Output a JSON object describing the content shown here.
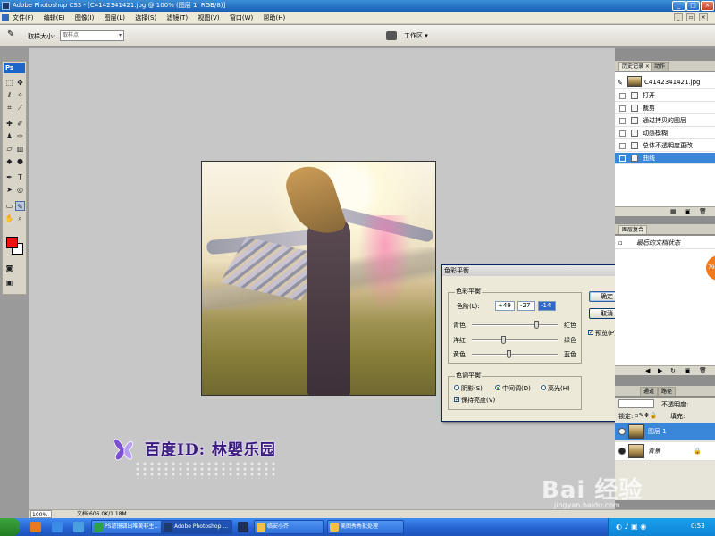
{
  "window": {
    "title": "Adobe Photoshop CS3 - [C4142341421.jpg @ 100% (图层 1, RGB/8)]"
  },
  "menubar": {
    "items": [
      "文件(F)",
      "编辑(E)",
      "图像(I)",
      "图层(L)",
      "选择(S)",
      "滤镜(T)",
      "视图(V)",
      "窗口(W)",
      "帮助(H)"
    ]
  },
  "options_bar": {
    "sample_size_label": "取样大小:",
    "sample_size_value": "取样点",
    "workspace_label": "工作区 ▾"
  },
  "toolbox": {
    "logo": "Ps",
    "foreground_color": "#f01010",
    "background_color": "#ffffff"
  },
  "watermark": {
    "text": "百度ID: 林婴乐园"
  },
  "color_balance": {
    "title": "色彩平衡",
    "group_color_balance": "色彩平衡",
    "levels_label": "色阶(L):",
    "levels": [
      "+49",
      "-27",
      "-14"
    ],
    "sliders": [
      {
        "left": "青色",
        "right": "红色",
        "value": 49
      },
      {
        "left": "洋红",
        "right": "绿色",
        "value": -27
      },
      {
        "left": "黄色",
        "right": "蓝色",
        "value": -14
      }
    ],
    "group_tone_balance": "色调平衡",
    "tones": [
      "阴影(S)",
      "中间调(D)",
      "高光(H)"
    ],
    "selected_tone": "中间调(D)",
    "preserve_luminosity": "保持亮度(V)",
    "ok": "确定",
    "cancel": "取消",
    "preview": "预览(P)"
  },
  "history_panel": {
    "tabs": [
      "历史记录 ×",
      "动作"
    ],
    "snapshot": "C4142341421.jpg",
    "items": [
      "打开",
      "裁剪",
      "通过拷贝的图层",
      "动感模糊",
      "总体不透明度更改",
      "曲线"
    ],
    "selected": "曲线"
  },
  "info_panel": {
    "tab": "图层复合",
    "text": "最后的文档状态"
  },
  "layers_panel": {
    "tabs": [
      "通道",
      "路径"
    ],
    "opacity_label": "不透明度:",
    "lock_label": "锁定:",
    "fill_label": "填充:",
    "layers": [
      "图层 1",
      "背景"
    ],
    "selected": "图层 1"
  },
  "statusbar": {
    "zoom": "100%",
    "doc": "文档:606.0K/1.18M"
  },
  "orange_tab": "79",
  "taskbar": {
    "tasks": [
      "PS滤镜调出唯美非主...",
      "Adobe Photoshop ...",
      "临安小芥",
      "美图秀秀批处理"
    ],
    "clock": "0:53"
  },
  "baidu_watermark": {
    "brand": "Bai 经验",
    "url": "jingyan.baidu.com"
  }
}
